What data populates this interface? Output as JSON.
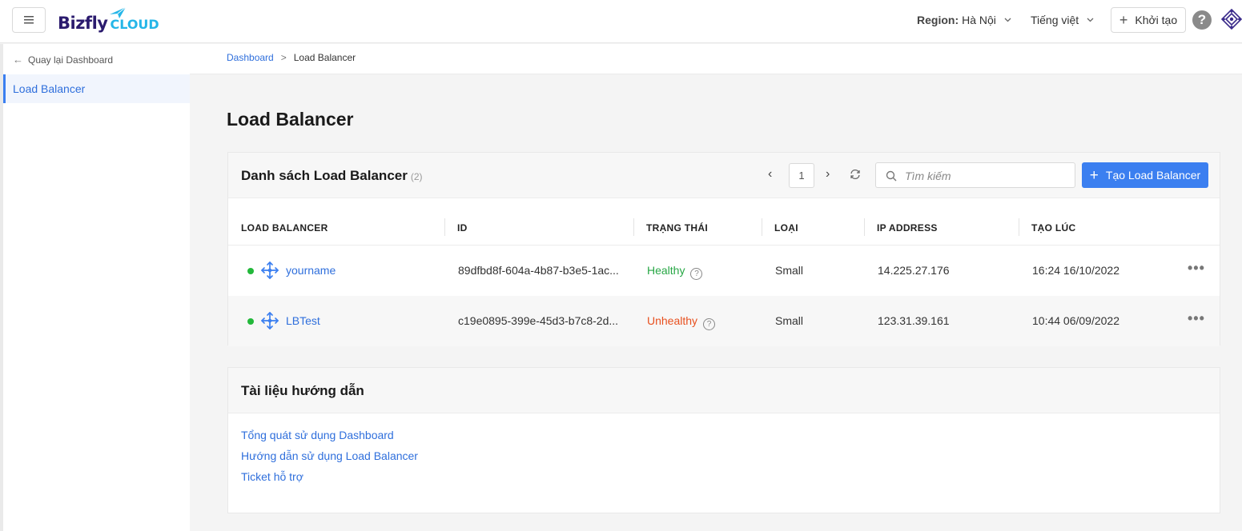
{
  "header": {
    "logo_main": "Bizfly",
    "logo_sub": "CLOUD",
    "region_label": "Region:",
    "region_value": "Hà Nội",
    "language": "Tiếng việt",
    "create_label": "Khởi tạo",
    "help_label": "?"
  },
  "sidebar": {
    "back_label": "Quay lại Dashboard",
    "items": [
      {
        "label": "Load Balancer"
      }
    ]
  },
  "breadcrumb": {
    "root": "Dashboard",
    "separator": ">",
    "current": "Load Balancer"
  },
  "page_title": "Load Balancer",
  "list": {
    "title": "Danh sách Load Balancer",
    "count": "(2)",
    "page": "1",
    "search_placeholder": "Tìm kiếm",
    "add_label": "Tạo Load Balancer",
    "columns": [
      "LOAD BALANCER",
      "ID",
      "TRẠNG THÁI",
      "LOẠI",
      "IP ADDRESS",
      "TẠO LÚC"
    ],
    "rows": [
      {
        "name": "yourname",
        "id": "89dfbd8f-604a-4b87-b3e5-1ac...",
        "status": "Healthy",
        "type": "Small",
        "ip": "14.225.27.176",
        "created": "16:24 16/10/2022"
      },
      {
        "name": "LBTest",
        "id": "c19e0895-399e-45d3-b7c8-2d...",
        "status": "Unhealthy",
        "type": "Small",
        "ip": "123.31.39.161",
        "created": "10:44 06/09/2022"
      }
    ]
  },
  "docs": {
    "title": "Tài liệu hướng dẫn",
    "links": [
      "Tổng quát sử dụng Dashboard",
      "Hướng dẫn sử dụng Load Balancer",
      "Ticket hỗ trợ"
    ]
  },
  "colors": {
    "accent": "#3b7ff0",
    "healthy": "#27a745",
    "unhealthy": "#e8501f",
    "logo": "#2b1b6e"
  }
}
